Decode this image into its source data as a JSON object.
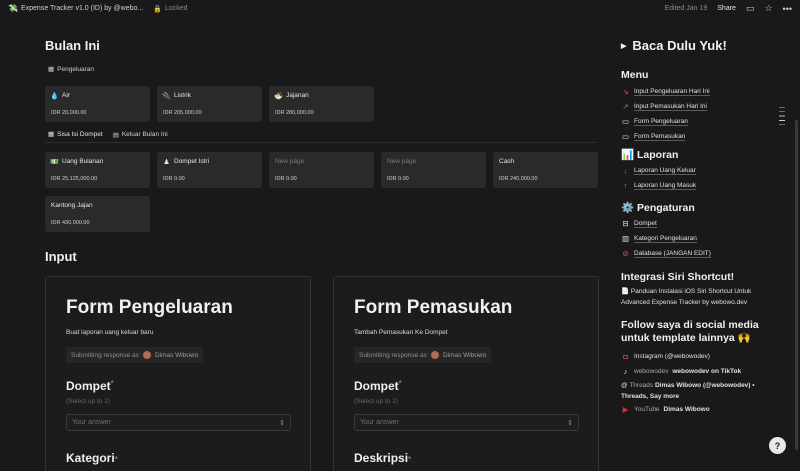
{
  "topbar": {
    "app_title": "Expense Tracker v1.0 (ID) by @webo...",
    "locked": "Locked",
    "edited": "Edited Jan 19",
    "share": "Share"
  },
  "main": {
    "section1_title": "Bulan Ini",
    "tab_pengeluaran": "Pengeluaran",
    "expense_cards": [
      {
        "icon": "droplet-icon",
        "title": "Air",
        "value": "IDR 20,000.00"
      },
      {
        "icon": "plug-icon",
        "title": "Listrik",
        "value": "IDR 205,000.00"
      },
      {
        "icon": "snack-icon",
        "title": "Jajanan",
        "value": "IDR 280,000.00"
      }
    ],
    "tab_sisa": "Sisa Isi Dompet",
    "tab_keluar": "Keluar Bulan Ini",
    "wallet_cards": [
      {
        "icon": "money-icon",
        "title": "Uang Bulanan",
        "value": "IDR 25,125,000.00",
        "muted": false
      },
      {
        "icon": "woman-icon",
        "title": "Dompet Istri",
        "value": "IDR 0.00",
        "muted": false
      },
      {
        "icon": "",
        "title": "New page",
        "value": "IDR 0.00",
        "muted": true
      },
      {
        "icon": "",
        "title": "New page",
        "value": "IDR 0.00",
        "muted": true
      },
      {
        "icon": "",
        "title": "Cash",
        "value": "IDR 240,000.00",
        "muted": false
      },
      {
        "icon": "",
        "title": "Kantong Jajan",
        "value": "IDR 430,000.00",
        "muted": false
      }
    ],
    "section2_title": "Input",
    "form1": {
      "title": "Form Pengeluaran",
      "desc": "Buat laporan uang keluar baru",
      "submitting": "Submitting response as",
      "user": "Dimas Wibowo",
      "q1": "Dompet",
      "hint": "(Select up to 1)",
      "placeholder": "Your answer",
      "q2": "Kategori"
    },
    "form2": {
      "title": "Form Pemasukan",
      "desc": "Tambah Pemasukan Ke Dompet",
      "submitting": "Submitting response as",
      "user": "Dimas Wibowo",
      "q1": "Dompet",
      "hint": "(Select up to 1)",
      "placeholder": "Your answer",
      "q2": "Deskripsi"
    }
  },
  "sidebar": {
    "toggle_title": "Baca Dulu Yuk!",
    "menu_title": "Menu",
    "menu_items": [
      {
        "icon": "arrow-down-right-icon",
        "label": "Input Pengeluaran Hari Ini",
        "color": "#e05a4f"
      },
      {
        "icon": "arrow-up-right-icon",
        "label": "Input Pemasukan Hari Ini",
        "color": "#3fb67a"
      },
      {
        "icon": "form-icon",
        "label": "Form Pengeluaran",
        "color": "#cfcfcf"
      },
      {
        "icon": "form-icon",
        "label": "Form Pemasukan",
        "color": "#cfcfcf"
      }
    ],
    "laporan_title": "📊 Laporan",
    "laporan_items": [
      {
        "icon": "arrow-down-icon",
        "label": "Laporan Uang Keluar",
        "color": "#e05a4f"
      },
      {
        "icon": "arrow-up-icon",
        "label": "Laporan Uang Masuk",
        "color": "#3fb67a"
      }
    ],
    "pengaturan_title": "⚙️ Pengaturan",
    "pengaturan_items": [
      {
        "icon": "wallet-icon",
        "label": "Dompet"
      },
      {
        "icon": "cabinet-icon",
        "label": "Kategori Pengeluaran"
      },
      {
        "icon": "no-entry-icon",
        "label": "Database (JANGAN EDIT)"
      }
    ],
    "siri_title": "Integrasi Siri Shortcut!",
    "siri_text": "📄 Panduan Instalasi iOS Siri Shortcut Untuk Advanced Expense Tracker by webowo.dev",
    "follow_title": "Follow saya di social media untuk template lainnya 🙌",
    "social": {
      "instagram": "Instagram (@webowodev)",
      "tiktok_user": "webowodev",
      "tiktok_rest": "webowodev on TikTok",
      "threads_label": "Threads",
      "threads_rest": "Dimas Wibowo (@webowodev) • Threads, Say more",
      "youtube_label": "YouTube",
      "youtube_rest": "Dimas Wibowo"
    }
  }
}
